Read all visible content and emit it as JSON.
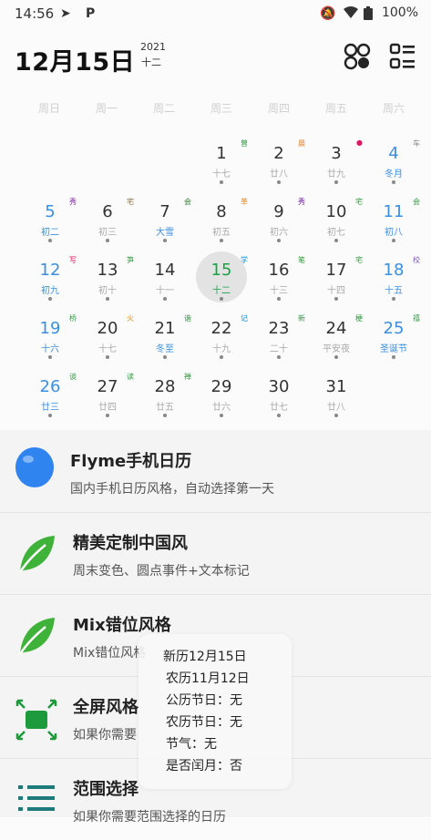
{
  "status_bar": {
    "time": "14:56",
    "battery": "100%"
  },
  "header": {
    "date": "12月15日",
    "year": "2021",
    "lunar_month": "十二"
  },
  "weekdays": [
    "周日",
    "周一",
    "周二",
    "周三",
    "周四",
    "周五",
    "周六"
  ],
  "calendar": {
    "days": [
      {
        "day": "1",
        "lunar": "十七",
        "mark": "曾",
        "mark_color": "#2e9a3e",
        "col": 3,
        "row": 0
      },
      {
        "day": "2",
        "lunar": "廿八",
        "mark": "晨",
        "mark_color": "#e08a2a",
        "col": 4,
        "row": 0
      },
      {
        "day": "3",
        "lunar": "廿九",
        "mark": "●",
        "mark_color": "#d81b60",
        "col": 5,
        "row": 0
      },
      {
        "day": "4",
        "lunar": "冬月",
        "mark": "车",
        "mark_color": "#888888",
        "col": 6,
        "row": 0,
        "weekend": true
      },
      {
        "day": "5",
        "lunar": "初二",
        "mark": "秀",
        "mark_color": "#7b1fa2",
        "col": 0,
        "row": 1,
        "weekend": true
      },
      {
        "day": "6",
        "lunar": "初三",
        "mark": "宅",
        "mark_color": "#8a6d3b",
        "col": 1,
        "row": 1
      },
      {
        "day": "7",
        "lunar": "大雪",
        "mark": "会",
        "mark_color": "#2e7d32",
        "col": 2,
        "row": 1,
        "fest": true
      },
      {
        "day": "8",
        "lunar": "初五",
        "mark": "革",
        "mark_color": "#e08a2a",
        "col": 3,
        "row": 1
      },
      {
        "day": "9",
        "lunar": "初六",
        "mark": "秀",
        "mark_color": "#6a1b9a",
        "col": 4,
        "row": 1
      },
      {
        "day": "10",
        "lunar": "初七",
        "mark": "宅",
        "mark_color": "#2e9a3e",
        "col": 5,
        "row": 1
      },
      {
        "day": "11",
        "lunar": "初八",
        "mark": "会",
        "mark_color": "#2e9a3e",
        "col": 6,
        "row": 1,
        "weekend": true
      },
      {
        "day": "12",
        "lunar": "初九",
        "mark": "写",
        "mark_color": "#d81b60",
        "col": 0,
        "row": 2,
        "weekend": true
      },
      {
        "day": "13",
        "lunar": "初十",
        "mark": "笋",
        "mark_color": "#2e9a3e",
        "col": 1,
        "row": 2
      },
      {
        "day": "14",
        "lunar": "十一",
        "mark": "",
        "mark_color": "#888888",
        "col": 2,
        "row": 2
      },
      {
        "day": "15",
        "lunar": "十二",
        "mark": "学",
        "mark_color": "#0288d1",
        "col": 3,
        "row": 2,
        "today": true
      },
      {
        "day": "16",
        "lunar": "十三",
        "mark": "笔",
        "mark_color": "#2e9a3e",
        "col": 4,
        "row": 2
      },
      {
        "day": "17",
        "lunar": "十四",
        "mark": "宅",
        "mark_color": "#2e9a3e",
        "col": 5,
        "row": 2
      },
      {
        "day": "18",
        "lunar": "十五",
        "mark": "校",
        "mark_color": "#7e57c2",
        "col": 6,
        "row": 2,
        "weekend": true
      },
      {
        "day": "19",
        "lunar": "十六",
        "mark": "桥",
        "mark_color": "#2e9a3e",
        "col": 0,
        "row": 3,
        "weekend": true
      },
      {
        "day": "20",
        "lunar": "十七",
        "mark": "火",
        "mark_color": "#e08a2a",
        "col": 1,
        "row": 3
      },
      {
        "day": "21",
        "lunar": "冬至",
        "mark": "谐",
        "mark_color": "#2e9a3e",
        "col": 2,
        "row": 3,
        "fest": true
      },
      {
        "day": "22",
        "lunar": "十九",
        "mark": "记",
        "mark_color": "#0288d1",
        "col": 3,
        "row": 3
      },
      {
        "day": "23",
        "lunar": "二十",
        "mark": "新",
        "mark_color": "#2e9a3e",
        "col": 4,
        "row": 3
      },
      {
        "day": "24",
        "lunar": "平安夜",
        "mark": "梗",
        "mark_color": "#2e9a3e",
        "col": 5,
        "row": 3
      },
      {
        "day": "25",
        "lunar": "圣诞节",
        "mark": "禧",
        "mark_color": "#2e9a3e",
        "col": 6,
        "row": 3,
        "weekend": true
      },
      {
        "day": "26",
        "lunar": "廿三",
        "mark": "谈",
        "mark_color": "#2e9a3e",
        "col": 0,
        "row": 4,
        "weekend": true
      },
      {
        "day": "27",
        "lunar": "廿四",
        "mark": "读",
        "mark_color": "#2e9a3e",
        "col": 1,
        "row": 4
      },
      {
        "day": "28",
        "lunar": "廿五",
        "mark": "禅",
        "mark_color": "#2e9a3e",
        "col": 2,
        "row": 4
      },
      {
        "day": "29",
        "lunar": "廿六",
        "mark": "",
        "mark_color": "#888888",
        "col": 3,
        "row": 4
      },
      {
        "day": "30",
        "lunar": "廿七",
        "mark": "",
        "mark_color": "#888888",
        "col": 4,
        "row": 4
      },
      {
        "day": "31",
        "lunar": "廿八",
        "mark": "",
        "mark_color": "#888888",
        "col": 5,
        "row": 4
      }
    ]
  },
  "styles": [
    {
      "title": "Flyme手机日历",
      "subtitle": "国内手机日历风格，自动选择第一天",
      "icon": "blue-balloon-icon"
    },
    {
      "title": "精美定制中国风",
      "subtitle": "周末变色、圆点事件+文本标记",
      "icon": "green-leaf-icon"
    },
    {
      "title": "Mix错位风格",
      "subtitle": "Mix错位风格",
      "icon": "green-leaf-icon"
    },
    {
      "title": "全屏风格",
      "subtitle": "如果你需要",
      "icon": "fullscreen-icon"
    },
    {
      "title": "范围选择",
      "subtitle": "如果你需要范围选择的日历",
      "icon": "list-icon"
    }
  ],
  "popup": {
    "lines": [
      "新历12月15日",
      "农历11月12日",
      "公历节日：无",
      "农历节日：无",
      "节气：无",
      "是否闰月：否"
    ]
  },
  "colors": {
    "accent_blue": "#3a8fe0",
    "today_green": "#1aa34a",
    "leaf_green": "#3fb23a"
  }
}
